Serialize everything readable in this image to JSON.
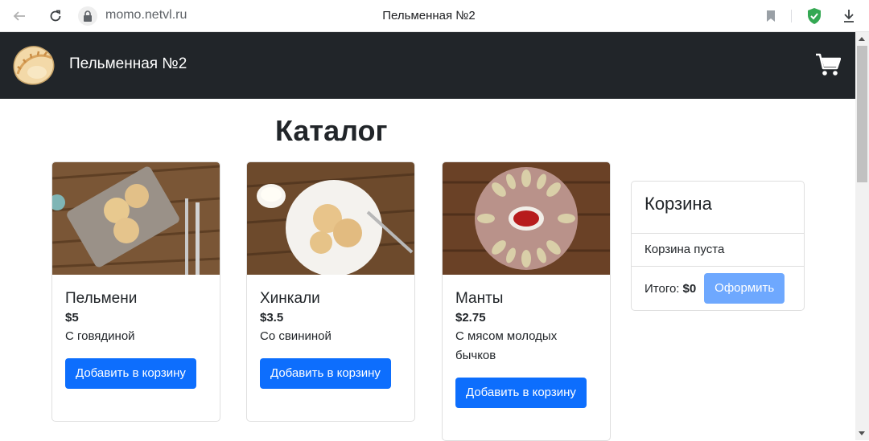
{
  "browser": {
    "url": "momo.netvl.ru",
    "tab_title": "Пельменная №2"
  },
  "navbar": {
    "brand": "Пельменная №2"
  },
  "catalog": {
    "title": "Каталог",
    "products": [
      {
        "name": "Пельмени",
        "price": "$5",
        "description": "С говядиной",
        "button": "Добавить в корзину"
      },
      {
        "name": "Хинкали",
        "price": "$3.5",
        "description": "Со свининой",
        "button": "Добавить в корзину"
      },
      {
        "name": "Манты",
        "price": "$2.75",
        "description": "С мясом молодых бычков",
        "button": "Добавить в корзину"
      }
    ]
  },
  "basket": {
    "title": "Корзина",
    "empty_text": "Корзина пуста",
    "total_label": "Итого:",
    "total_value": "$0",
    "checkout_button": "Оформить"
  },
  "colors": {
    "navbar_bg": "#212529",
    "primary": "#0d6efd",
    "primary_disabled": "#6ea8fe"
  }
}
